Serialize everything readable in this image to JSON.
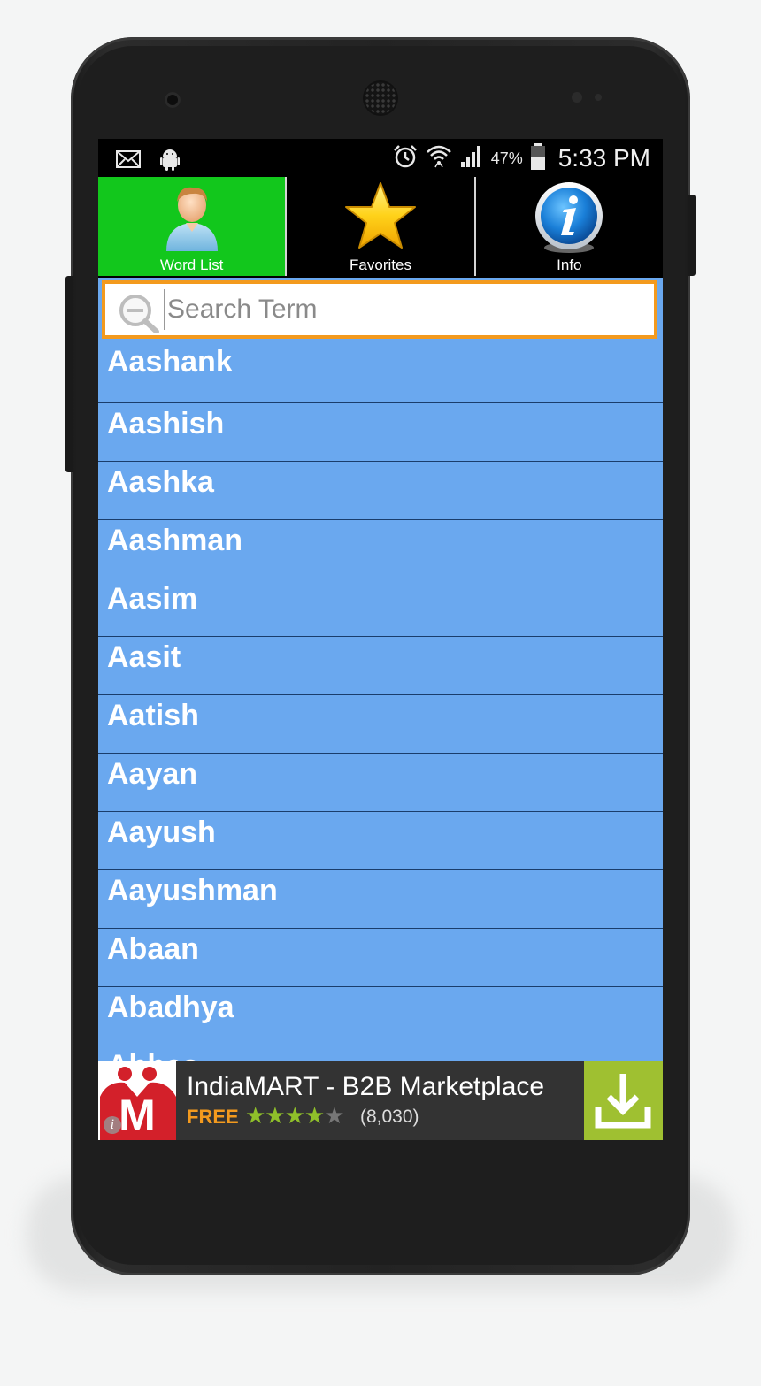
{
  "status_bar": {
    "icons_left": [
      "mail-icon",
      "android-icon"
    ],
    "icons_right": [
      "alarm-icon",
      "wifi-icon",
      "signal-icon",
      "battery-icon"
    ],
    "battery": "47%",
    "time": "5:33 PM"
  },
  "tabs": [
    {
      "label": "Word List",
      "icon": "user-icon",
      "active": true
    },
    {
      "label": "Favorites",
      "icon": "star-icon",
      "active": false
    },
    {
      "label": "Info",
      "icon": "info-icon",
      "active": false
    }
  ],
  "search": {
    "placeholder": "Search Term",
    "value": ""
  },
  "list": {
    "items": [
      "Aashank",
      "Aashish",
      "Aashka",
      "Aashman",
      "Aasim",
      "Aasit",
      "Aatish",
      "Aayan",
      "Aayush",
      "Aayushman",
      "Abaan",
      "Abadhya",
      "Abbas"
    ]
  },
  "ad": {
    "title": "IndiaMART - B2B Marketplace",
    "price": "FREE",
    "rating": 4.5,
    "reviews": "(8,030)",
    "logo_letter": "M"
  },
  "colors": {
    "active_tab": "#12c71c",
    "list_bg": "#6aa8ef",
    "search_border": "#f39a1e",
    "download_button": "#9fc031"
  }
}
